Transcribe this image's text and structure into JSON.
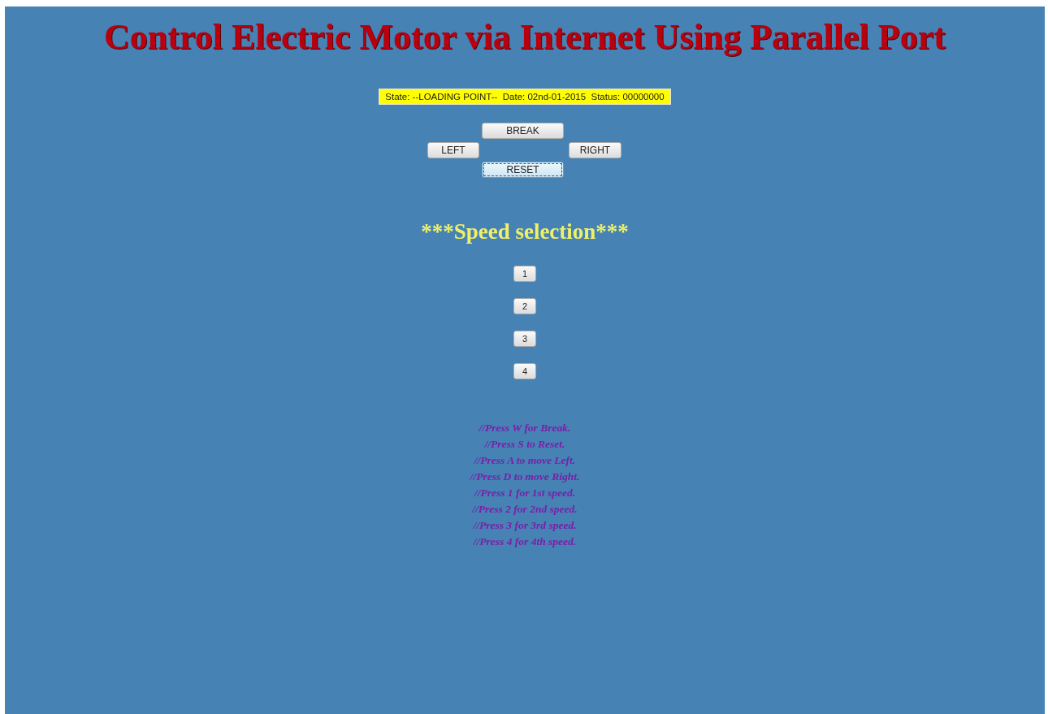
{
  "title": "Control Electric Motor via Internet Using Parallel Port",
  "status_bar": "State: --LOADING POINT--  Date: 02nd-01-2015  Status: 00000000",
  "direction_buttons": [
    {
      "label": "BREAK",
      "kind": "up",
      "focused": false
    },
    {
      "label": "LEFT",
      "kind": "left",
      "focused": false
    },
    {
      "label": "RIGHT",
      "kind": "right",
      "focused": false
    },
    {
      "label": "RESET",
      "kind": "down",
      "focused": true
    }
  ],
  "speed_heading": "***Speed selection***",
  "speed_buttons": [
    {
      "label": "1",
      "focused": false
    },
    {
      "label": "2",
      "focused": false
    },
    {
      "label": "3",
      "focused": false
    },
    {
      "label": "4",
      "focused": false
    }
  ],
  "instructions": [
    "//Press W for Break.",
    "//Press S to Reset.",
    "//Press A to move Left.",
    "//Press D to move Right.",
    "//Press 1 for 1st speed.",
    "//Press 2 for 2nd speed.",
    "//Press 3 for 3rd speed.",
    "//Press 4 for 4th speed."
  ]
}
